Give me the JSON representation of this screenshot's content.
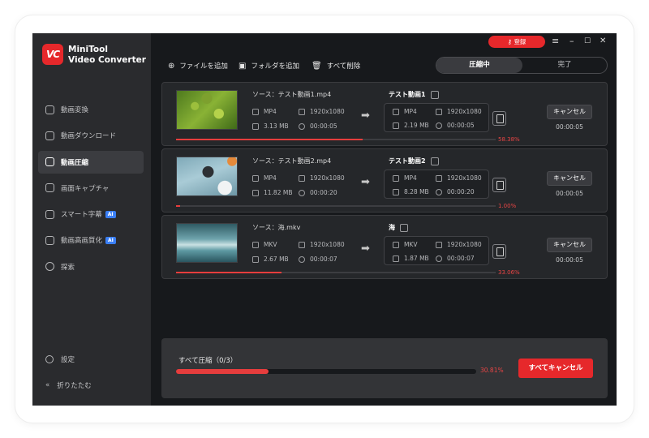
{
  "app": {
    "brand_line1": "MiniTool",
    "brand_line2": "Video Converter",
    "logo_text": "VC"
  },
  "titlebar": {
    "login_label": "登録",
    "menu_icon": "≡",
    "minimize_icon": "–",
    "maximize_icon": "☐",
    "close_icon": "✕"
  },
  "sidebar": {
    "items": [
      {
        "label": "動画変換"
      },
      {
        "label": "動画ダウンロード"
      },
      {
        "label": "動画圧縮"
      },
      {
        "label": "画面キャプチャ"
      },
      {
        "label": "スマート字幕",
        "badge": "AI"
      },
      {
        "label": "動画高画質化",
        "badge": "AI"
      },
      {
        "label": "探索"
      }
    ],
    "settings": "設定",
    "collapse": "折りたたむ",
    "collapse_icon": "«"
  },
  "toolbar": {
    "add_file": "ファイルを追加",
    "add_folder": "フォルダを追加",
    "delete_all": "すべて削除",
    "tab_compressing": "圧縮中",
    "tab_done": "完了"
  },
  "common": {
    "source_prefix": "ソース：",
    "arrow": "➡"
  },
  "tasks": [
    {
      "source": "テスト動画1.mp4",
      "src_format": "MP4",
      "src_resolution": "1920x1080",
      "src_size": "3.13 MB",
      "src_duration": "00:00:05",
      "output_name": "テスト動画1",
      "out_format": "MP4",
      "out_resolution": "1920x1080",
      "out_size": "2.19 MB",
      "out_duration": "00:00:05",
      "cancel_label": "キャンセル",
      "time": "00:00:05",
      "progress_text": "58.38%",
      "progress": 0.5838
    },
    {
      "source": "テスト動画2.mp4",
      "src_format": "MP4",
      "src_resolution": "1920x1080",
      "src_size": "11.82 MB",
      "src_duration": "00:00:20",
      "output_name": "テスト動画2",
      "out_format": "MP4",
      "out_resolution": "1920x1080",
      "out_size": "8.28 MB",
      "out_duration": "00:00:20",
      "cancel_label": "キャンセル",
      "time": "00:00:05",
      "progress_text": "1.00%",
      "progress": 0.01
    },
    {
      "source": "海.mkv",
      "src_format": "MKV",
      "src_resolution": "1920x1080",
      "src_size": "2.67 MB",
      "src_duration": "00:00:07",
      "output_name": "海",
      "out_format": "MKV",
      "out_resolution": "1920x1080",
      "out_size": "1.87 MB",
      "out_duration": "00:00:07",
      "cancel_label": "キャンセル",
      "time": "00:00:05",
      "progress_text": "33.06%",
      "progress": 0.3306
    }
  ],
  "footer": {
    "all_title": "すべて圧縮（0/3）",
    "all_progress_text": "30.81%",
    "all_progress": 0.3081,
    "cancel_all": "すべてキャンセル"
  },
  "colors": {
    "accent": "#e6282b",
    "progress": "#e63d3d",
    "background": "#17191c",
    "sidebar": "#2a2b2e"
  }
}
